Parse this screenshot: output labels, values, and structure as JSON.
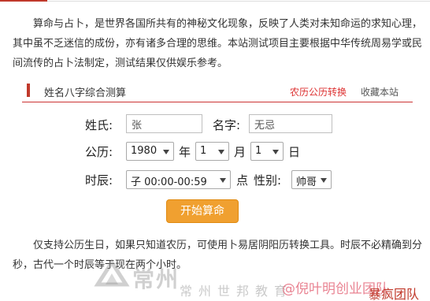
{
  "intro_text": "算命与占卜，是世界各国所共有的神秘文化现象，反映了人类对未知命运的求知心理，其中虽不乏迷信的成份，亦有诸多合理的思维。本站测试项目主要根据中华传统周易学或民间流传的占卜法制定，测试结果仅供娱乐参考。",
  "panel": {
    "title": "姓名八字综合测算",
    "link_convert": "农历公历转换",
    "link_bookmark": "收藏本站"
  },
  "form": {
    "surname_label": "姓氏:",
    "surname_value": "张",
    "name_label": "名字:",
    "name_value": "无忌",
    "calendar_label": "公历:",
    "year_value": "1980",
    "year_unit": "年",
    "month_value": "1",
    "month_unit": "月",
    "day_value": "1",
    "day_unit": "日",
    "hour_label": "时辰:",
    "hour_value": "子 00:00-00:59",
    "hour_unit": "点",
    "gender_label": "性别:",
    "gender_value": "帅哥",
    "submit_label": "开始算命"
  },
  "note_text": "仅支持公历生日，如果只知道农历，可使用卜易居阴阳历转换工具。时辰不必精确到分秒，古代一个时辰等于现在两个小时。",
  "watermark": {
    "main_text": "常州",
    "sub_text": "常州世邦教育",
    "at_text": "@倪叶明创业团队",
    "red_text": "暴疯团队"
  }
}
